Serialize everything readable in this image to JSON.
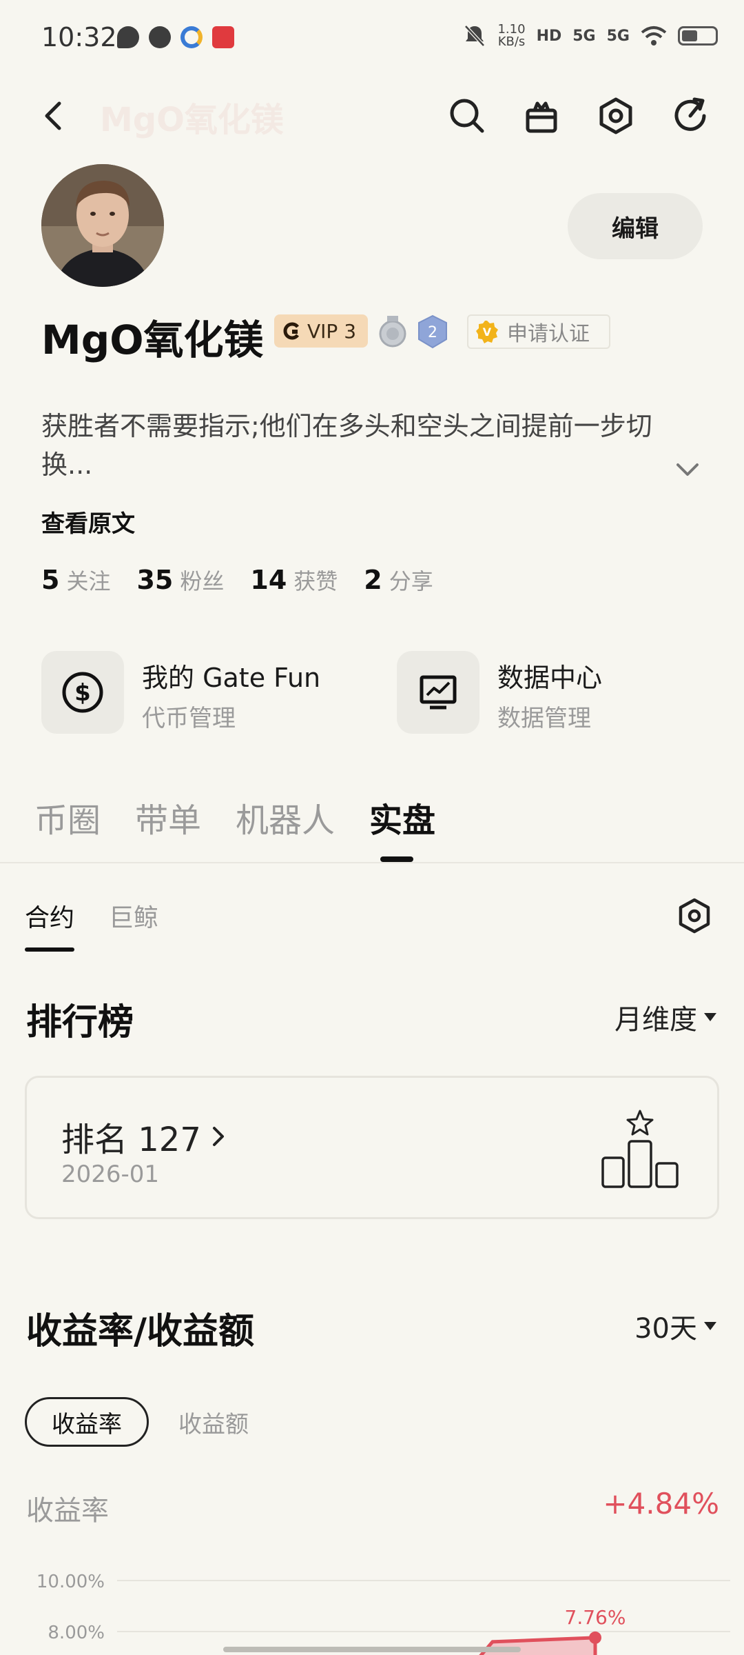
{
  "status_bar": {
    "time": "10:32",
    "net_speed_top": "1.10",
    "net_speed_bottom": "KB/s",
    "hd_badge": "HD",
    "signal_1": "5G",
    "signal_2": "5G"
  },
  "nav": {
    "ghost_title": "MgO氧化镁",
    "icons": [
      "back-icon",
      "search-icon",
      "gift-icon",
      "settings-icon",
      "share-icon"
    ]
  },
  "profile": {
    "username": "MgO氧化镁",
    "edit_label": "编辑",
    "vip_label": "VIP 3",
    "level_medal": "2",
    "verify_label": "申请认证",
    "verify_mark": "V",
    "bio": "获胜者不需要指示;他们在多头和空头之间提前一步切换...",
    "view_original": "查看原文",
    "stats": [
      {
        "value": "5",
        "label": "关注"
      },
      {
        "value": "35",
        "label": "粉丝"
      },
      {
        "value": "14",
        "label": "获赞"
      },
      {
        "value": "2",
        "label": "分享"
      }
    ]
  },
  "quick_cards": [
    {
      "title": "我的 Gate Fun",
      "subtitle": "代币管理",
      "icon": "dollar-icon"
    },
    {
      "title": "数据中心",
      "subtitle": "数据管理",
      "icon": "chart-monitor-icon"
    }
  ],
  "main_tabs": [
    "币圈",
    "带单",
    "机器人",
    "实盘"
  ],
  "main_tab_active": "实盘",
  "sub_tabs": [
    "合约",
    "巨鲸"
  ],
  "ranking": {
    "title": "排行榜",
    "period": "月维度",
    "rank_label": "排名 127",
    "date": "2026-01"
  },
  "returns": {
    "title": "收益率/收益额",
    "period": "30天",
    "tabs": [
      "收益率",
      "收益额"
    ],
    "label": "收益率",
    "value": "+4.84%"
  },
  "chart_data": {
    "type": "area",
    "y_ticks": [
      "10.00%",
      "8.00%"
    ],
    "peak_label": "7.76%",
    "peak_value": 7.76,
    "ylim": [
      8.0,
      10.0
    ],
    "color": "#e0505c"
  },
  "colors": {
    "background": "#f7f6f0",
    "accent_red": "#e0505c",
    "vip_bg": "#f5d9b6",
    "verify_gold": "#f2b31a"
  }
}
